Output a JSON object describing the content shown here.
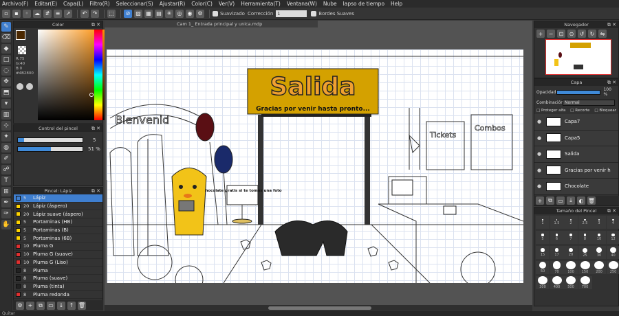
{
  "menu": [
    "Archivo(F)",
    "Editar(E)",
    "Capa(L)",
    "Filtro(R)",
    "Seleccionar(S)",
    "Ajustar(R)",
    "Color(C)",
    "Ver(V)",
    "Herramienta(T)",
    "Ventana(W)",
    "Nube",
    "lapso de tiempo",
    "Help"
  ],
  "toolbar": {
    "suavizado": "Suavizado",
    "correccion": "Corrección",
    "correccion_value": "1",
    "bordes": "Bordes Suaves"
  },
  "document_tab": "Cam 1_ Entrada principal y unica.mdp",
  "color_panel": {
    "title": "Color",
    "r": "R:75",
    "g": "G:40",
    "b": "B:0",
    "hex": "#4B2800"
  },
  "brush_control": {
    "title": "Control del pincel",
    "size_value": "5",
    "opacity_value": "51 %",
    "size_fill": 0.1,
    "opacity_fill": 0.51
  },
  "brush_list": {
    "title": "Pincel: Lápiz",
    "items": [
      {
        "size": "5",
        "name": "Lápiz",
        "color": "#3f7fd0",
        "selected": true
      },
      {
        "size": "20",
        "name": "Lápiz (áspero)",
        "color": "#ffd400"
      },
      {
        "size": "20",
        "name": "Lápiz suave (áspero)",
        "color": "#ffd400"
      },
      {
        "size": "5",
        "name": "Portaminas (HB)",
        "color": "#ffd400"
      },
      {
        "size": "5",
        "name": "Portaminas (B)",
        "color": "#ffd400"
      },
      {
        "size": "5",
        "name": "Portaminas (6B)",
        "color": "#ffd400"
      },
      {
        "size": "10",
        "name": "Pluma G",
        "color": "#e03030"
      },
      {
        "size": "10",
        "name": "Pluma G (suave)",
        "color": "#e03030"
      },
      {
        "size": "10",
        "name": "Pluma G (Liso)",
        "color": "#e03030"
      },
      {
        "size": "8",
        "name": "Pluma",
        "color": "#222222"
      },
      {
        "size": "8",
        "name": "Pluma (suave)",
        "color": "#222222"
      },
      {
        "size": "8",
        "name": "Pluma (tinta)",
        "color": "#222222"
      },
      {
        "size": "8",
        "name": "Pluma redonda",
        "color": "#e03030"
      }
    ]
  },
  "navigator": {
    "title": "Navegador"
  },
  "layers": {
    "title": "Capa",
    "opacity_label": "Opacidad",
    "opacity_value": "100 %",
    "blend_label": "Combinación",
    "blend_value": "Normal",
    "protect_alpha": "Proteger alfa",
    "clip": "Recorte",
    "lock": "Bloquear",
    "items": [
      {
        "name": "Capa7"
      },
      {
        "name": "Capa5"
      },
      {
        "name": "Salida"
      },
      {
        "name": "Gracias por venir h"
      },
      {
        "name": "Chocolate"
      }
    ]
  },
  "brush_size": {
    "title": "Tamaño del Pincel",
    "sizes": [
      "1",
      "1.5",
      "2",
      "2.5",
      "3",
      "4",
      "5",
      "6",
      "7",
      "8",
      "10",
      "12",
      "15",
      "17",
      "20",
      "25",
      "30",
      "40",
      "50",
      "70",
      "100",
      "150",
      "200",
      "250",
      "300",
      "400",
      "500",
      "700"
    ]
  },
  "artwork": {
    "sign_title": "Salida",
    "sign_sub": "Gracias por venir hasta pronto...",
    "welcome": "Bienvenid",
    "tickets": "Tickets",
    "combos": "Combos",
    "chocolate_sign": "Chocolate gratis si te tomas una foto"
  },
  "status": "Quitar"
}
